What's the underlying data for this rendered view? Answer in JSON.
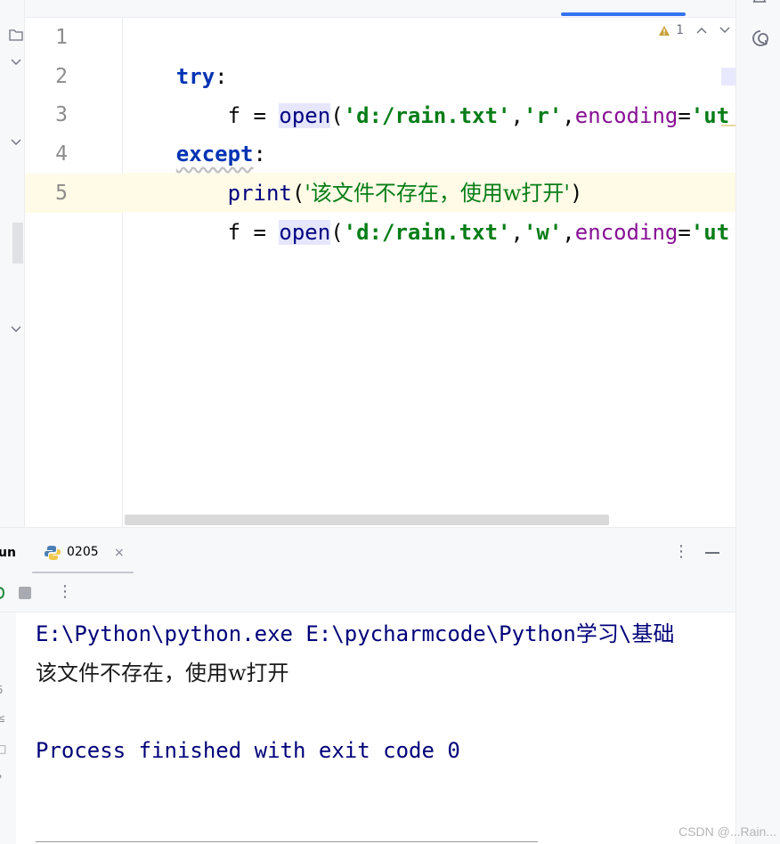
{
  "editor": {
    "line_numbers": [
      "1",
      "2",
      "3",
      "4",
      "5"
    ],
    "inspection": {
      "warning_count": "1"
    },
    "code": {
      "l1_try": "try",
      "l1_colon": ":",
      "l2_indent": "    f = ",
      "l2_open": "open",
      "l2_paren": "(",
      "l2_path": "'d:/rain.txt'",
      "l2_comma1": ",",
      "l2_mode": "'r'",
      "l2_comma2": ",",
      "l2_encoding": "encoding",
      "l2_eq": "=",
      "l2_enc_val": "'ut",
      "l3_except": "except",
      "l3_colon": ":",
      "l4_indent": "    ",
      "l4_print": "print",
      "l4_paren_open": "(",
      "l4_msg": "'该文件不存在，使用w打开'",
      "l4_paren_close": ")",
      "l5_indent": "    f = ",
      "l5_open": "open",
      "l5_paren": "(",
      "l5_path": "'d:/rain.txt'",
      "l5_comma1": ",",
      "l5_mode": "'w'",
      "l5_comma2": ",",
      "l5_encoding": "encoding",
      "l5_eq": "=",
      "l5_enc_val": "'ut"
    }
  },
  "run_panel": {
    "title": "un",
    "tab_label": "0205",
    "tab_close": "×",
    "more": "⋮",
    "gutter_glyphs": [
      "5",
      "≤",
      "□",
      "?"
    ]
  },
  "console": {
    "line1": "E:\\Python\\python.exe E:\\pycharmcode\\Python学习\\基础",
    "line2": "该文件不存在，使用w打开",
    "line3": "Process finished with exit code 0"
  },
  "watermark": "CSDN @...Rain...",
  "colors": {
    "accent": "#3574f0",
    "keyword": "#0033b3",
    "string": "#067d17",
    "param": "#871094"
  }
}
